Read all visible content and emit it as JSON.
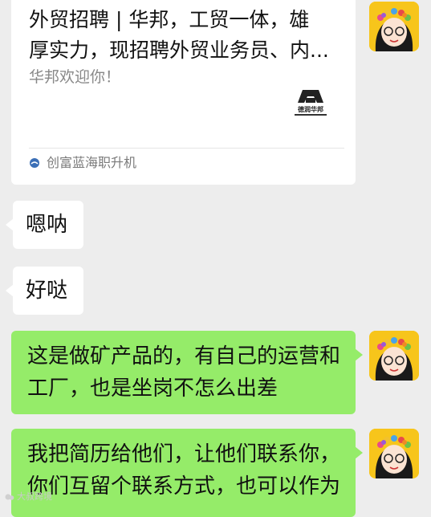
{
  "card": {
    "title": "外贸招聘 | 华邦，工贸一体，雄厚实力，现招聘外贸业务员、内...",
    "title_line1": "外贸招聘 | 华邦，工贸一体，雄",
    "title_line2": "厚实力，现招聘外贸业务员、内...",
    "subtitle": "华邦欢迎你！",
    "logo_text": "德润华邦",
    "source": "创富蓝海职升机"
  },
  "messages": [
    {
      "side": "left",
      "text": "嗯呐"
    },
    {
      "side": "left",
      "text": "好哒"
    },
    {
      "side": "right",
      "text": "这是做矿产品的，有自己的运营和工厂，也是坐岗不怎么出差",
      "line1": "这是做矿产品的，有自己的运营和",
      "line2": "工厂，也是坐岗不怎么出差"
    },
    {
      "side": "right",
      "text": "我把简历给他们，让他们联系你，你们互留个联系方式，也可以作为",
      "line1": "我把简历给他们，让他们联系你，",
      "line2": "你们互留个联系方式，也可以作为"
    }
  ],
  "watermark": "大叔跨境",
  "colors": {
    "background": "#ededed",
    "bubble_self": "#95ec69",
    "bubble_other": "#ffffff",
    "avatar_bg": "#f7c51b"
  },
  "icons": [
    "avatar-cartoon-girl",
    "brand-logo",
    "source-icon"
  ]
}
